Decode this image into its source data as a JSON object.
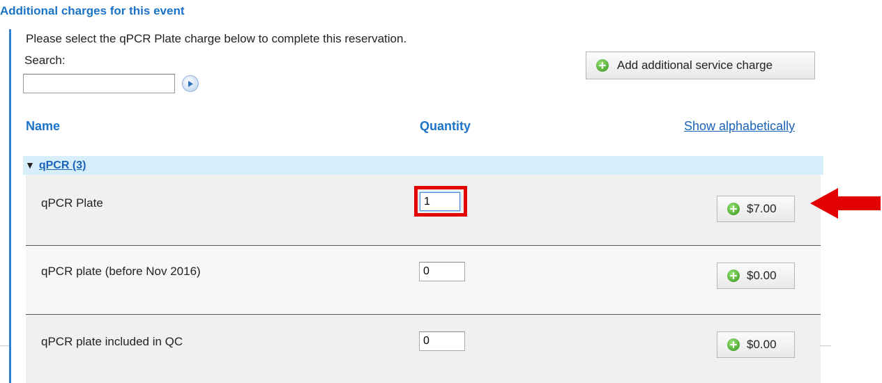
{
  "section": {
    "title": "Additional charges for this event",
    "instructions": "Please select the qPCR Plate charge below to complete this reservation."
  },
  "search": {
    "label": "Search:",
    "value": "",
    "placeholder": ""
  },
  "add_charge_button": {
    "label": "Add additional service charge",
    "icon": "plus-circle-icon"
  },
  "columns": {
    "name": "Name",
    "quantity": "Quantity",
    "sort_link": "Show alphabetically"
  },
  "group": {
    "label": "qPCR (3)",
    "expanded": true
  },
  "items": [
    {
      "name": "qPCR Plate",
      "quantity": "1",
      "price": "$7.00",
      "highlighted": true
    },
    {
      "name": "qPCR plate (before Nov 2016)",
      "quantity": "0",
      "price": "$0.00"
    },
    {
      "name": "qPCR plate included in QC",
      "quantity": "0",
      "price": "$0.00"
    }
  ],
  "colors": {
    "accent": "#1a73c7",
    "group_bg": "#d8effb",
    "highlight": "#e20000",
    "plus_icon": "#4aa62d"
  }
}
